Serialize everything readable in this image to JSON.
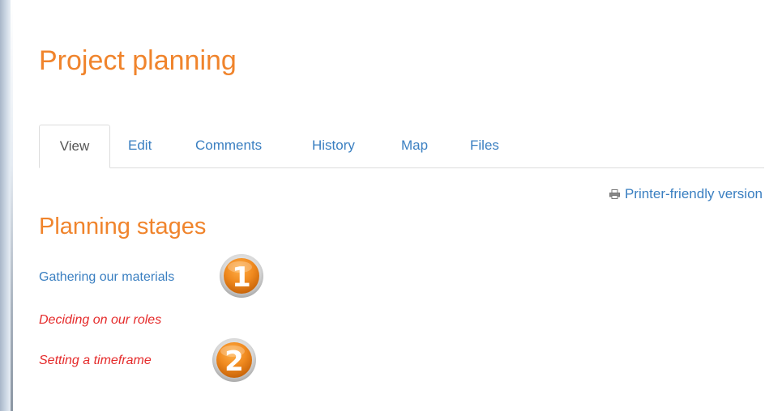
{
  "page": {
    "title": "Project planning"
  },
  "tabs": [
    {
      "label": "View",
      "active": true
    },
    {
      "label": "Edit"
    },
    {
      "label": "Comments"
    },
    {
      "label": "History"
    },
    {
      "label": "Map"
    },
    {
      "label": "Files"
    }
  ],
  "printer": {
    "label": "Printer-friendly version",
    "icon": "printer-icon"
  },
  "section": {
    "heading": "Planning stages",
    "items": [
      {
        "label": "Gathering our materials",
        "style": "link",
        "badge": "1"
      },
      {
        "label": "Deciding on our roles",
        "style": "missing-link"
      },
      {
        "label": "Setting a timeframe",
        "style": "missing-link",
        "badge": "2"
      }
    ]
  },
  "colors": {
    "heading_orange": "#f0842c",
    "link_blue": "#3a7fc1",
    "missing_red": "#e52b2b",
    "badge_orange": "#f08a1f"
  }
}
